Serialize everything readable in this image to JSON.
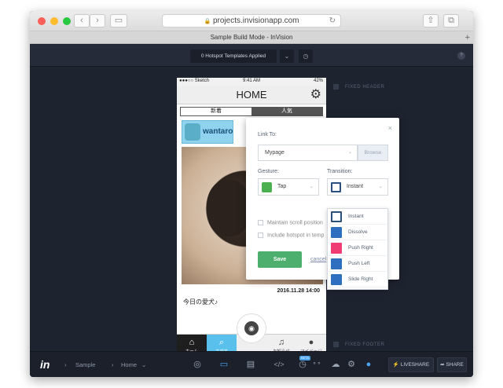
{
  "browser": {
    "url": "projects.invisionapp.com",
    "tab_title": "Sample Build Mode - InVision",
    "back_icon": "‹",
    "forward_icon": "›",
    "sidebar_icon": "▭",
    "lock_icon": "🔒",
    "reload_icon": "↻",
    "share_icon": "⇧",
    "tabs_icon": "⧉",
    "plus_icon": "+"
  },
  "toolbar": {
    "templates_label": "0 Hotspot Templates Applied",
    "caret_icon": "⌄",
    "timer_icon": "◷",
    "help_icon": "?"
  },
  "stage": {
    "fixed_header_label": "FIXED HEADER",
    "fixed_footer_label": "FIXED FOOTER"
  },
  "phone": {
    "carrier": "●●●○○ Sketch",
    "time": "9:41 AM",
    "battery": "42%",
    "nav_title": "HOME",
    "gear_icon": "⚙",
    "segments": [
      "新着",
      "人気"
    ],
    "card_user": "wantaro",
    "post_date": "2016.11.28 14:00",
    "caption": "今日の愛犬♪",
    "camera_icon": "◉",
    "tabs": [
      {
        "label": "ホーム",
        "icon": "⌂"
      },
      {
        "label": "さがす",
        "icon": "⌕"
      },
      {
        "label": "",
        "icon": ""
      },
      {
        "label": "お知らせ",
        "icon": "♫"
      },
      {
        "label": "マイページ",
        "icon": "●"
      }
    ]
  },
  "modal": {
    "link_to_label": "Link To:",
    "link_to_value": "Mypage",
    "browse_label": "Browse",
    "gesture_label": "Gesture:",
    "gesture_value": "Tap",
    "transition_label": "Transition:",
    "transition_value": "Instant",
    "maintain_scroll": "Maintain scroll position",
    "include_hotspot": "Include hotspot in temp",
    "save_label": "Save",
    "cancel_label": "cancel",
    "close_icon": "×",
    "chevron_icon": "⌄",
    "transitions": [
      {
        "label": "Instant",
        "color": "#2a4f80"
      },
      {
        "label": "Dissolve",
        "color": "#2f6fc0"
      },
      {
        "label": "Push Right",
        "color": "#ef3d73"
      },
      {
        "label": "Push Left",
        "color": "#2f6fc0"
      },
      {
        "label": "Slide Right",
        "color": "#2f6fc0"
      }
    ]
  },
  "bottom": {
    "logo": "in",
    "crumb_project": "Sample",
    "crumb_screen": "Home",
    "crumb_sep": "›",
    "crumb_caret": "⌄",
    "icons": [
      "◎",
      "▭",
      "▤",
      "</>",
      "◷",
      "⚬⚬",
      "☁",
      "⚙",
      "●"
    ],
    "beta_label": "BETA",
    "liveshare_label": "LIVESHARE",
    "share_label": "SHARE",
    "liveshare_icon": "⚡",
    "share_icon": "➦"
  }
}
